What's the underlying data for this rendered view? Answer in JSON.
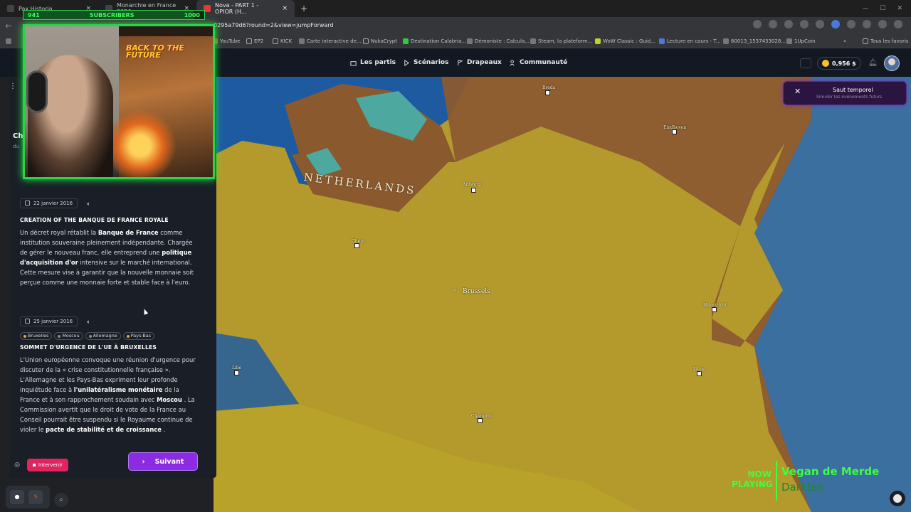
{
  "browser": {
    "tabs": [
      {
        "title": "Pax Historia",
        "active": false
      },
      {
        "title": "Monarchie en France 2026",
        "active": false
      },
      {
        "title": "Nova - PART 1 - OPIOR (H...",
        "active": true
      }
    ],
    "url": "0295a79d6?round=2&view=jumpForward",
    "bookmarks": [
      "YouTube",
      "EP2",
      "KICK",
      "Carte interactive de...",
      "NukaCrypt",
      "Destination Calabria...",
      "Démoniste : Calcula...",
      "Steam, la plateform...",
      "WoW Classic : Guid...",
      "Lecture en cours - T...",
      "60013_1537433028...",
      "1UpCoin"
    ],
    "all_bookmarks": "Tous les favoris"
  },
  "stream": {
    "subs_current": "941",
    "subs_label": "SUBSCRIBERS",
    "subs_goal": "1000",
    "subs_progress": 0.941,
    "poster_title": "BACK TO THE FUTURE",
    "now_playing_label": "NOW PLAYING",
    "song": "Vegan de Merde",
    "artist": "Darktek"
  },
  "app": {
    "nav": [
      "Les partis",
      "Scénarios",
      "Drapeaux",
      "Communauté"
    ],
    "balance": "0,956 $",
    "time_jump": {
      "title": "Saut temporel",
      "subtitle": "Simuler les événements futurs"
    },
    "panel": {
      "heading_partial": "Ch",
      "sub_partial": "du",
      "events": [
        {
          "date": "22 janvier 2016",
          "title": "CREATION OF THE BANQUE DE FRANCE ROYALE",
          "body_html": "Un décret royal rétablit la <b>Banque de France</b> comme institution souveraine pleinement indépendante. Chargée de gérer le nouveau franc, elle entreprend une <b>politique d'acquisition d'or</b> intensive sur le marché international. Cette mesure vise à garantir que la nouvelle monnaie soit perçue comme une monnaie forte et stable face à l'euro."
        },
        {
          "date": "25 janvier 2016",
          "tags": [
            "Bruxelles",
            "Moscou",
            "Allemagne",
            "Pays-Bas"
          ],
          "title": "SOMMET D'URGENCE DE L'UE À BRUXELLES",
          "body_html": "L'Union européenne convoque une réunion d'urgence pour discuter de la « crise constitutionnelle française ». L'Allemagne et les Pays-Bas expriment leur profonde inquiétude face à <b>l'unilatéralisme monétaire</b> de la France et à son rapprochement soudain avec <b>Moscou</b> . La Commission avertit que le droit de vote de la France au Conseil pourrait être suspendu si le Royaume continue de violer le <b>pacte de stabilité et de croissance</b> ."
        }
      ],
      "intervene_label": "Intervenir",
      "next_label": "Suivant"
    },
    "map": {
      "country_label": "NETHERLANDS",
      "capital": "Brussels",
      "cities": [
        "Antwerp",
        "Ghent",
        "Lille",
        "Maastricht",
        "Charleroi",
        "Eindhoven",
        "Breda",
        "Liège"
      ],
      "colors": {
        "sea": "#1e5aa0",
        "belgium": "#b49a2c",
        "netherlands": "#8a5a2e",
        "germany": "#8c5a30",
        "france": "#b8a22a"
      }
    }
  }
}
